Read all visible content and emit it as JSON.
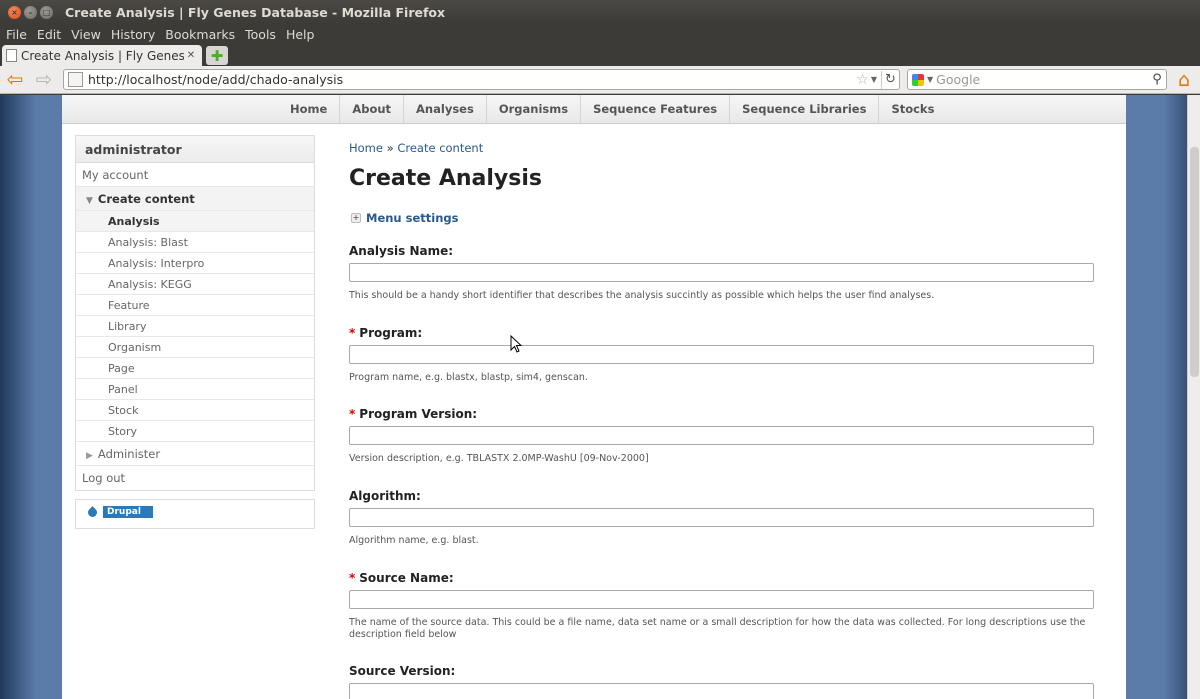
{
  "window": {
    "title": "Create Analysis | Fly Genes Database - Mozilla Firefox"
  },
  "menubar": {
    "items": [
      "File",
      "Edit",
      "View",
      "History",
      "Bookmarks",
      "Tools",
      "Help"
    ]
  },
  "tabs": [
    {
      "label": "Create Analysis | Fly Genes Dat…"
    }
  ],
  "navbar": {
    "url": "http://localhost/node/add/chado-analysis",
    "search_placeholder": "Google"
  },
  "site_nav": {
    "items": [
      "Home",
      "About",
      "Analyses",
      "Organisms",
      "Sequence Features",
      "Sequence Libraries",
      "Stocks"
    ]
  },
  "sidebar": {
    "title": "administrator",
    "my_account": "My account",
    "create_content": "Create content",
    "create_items": [
      "Analysis",
      "Analysis: Blast",
      "Analysis: Interpro",
      "Analysis: KEGG",
      "Feature",
      "Library",
      "Organism",
      "Page",
      "Panel",
      "Stock",
      "Story"
    ],
    "active_item": "Analysis",
    "administer": "Administer",
    "log_out": "Log out",
    "drupal_badge": "Drupal"
  },
  "main": {
    "breadcrumb": {
      "home": "Home",
      "separator": "»",
      "current": "Create content"
    },
    "title": "Create Analysis",
    "menu_settings": "Menu settings",
    "fields": [
      {
        "label": "Analysis Name:",
        "required": false,
        "value": "",
        "description": "This should be a handy short identifier that describes the analysis succintly as possible which helps the user find analyses."
      },
      {
        "label": "Program:",
        "required": true,
        "value": "",
        "description": "Program name, e.g. blastx, blastp, sim4, genscan."
      },
      {
        "label": "Program Version:",
        "required": true,
        "value": "",
        "description": "Version description, e.g. TBLASTX 2.0MP-WashU [09-Nov-2000]"
      },
      {
        "label": "Algorithm:",
        "required": false,
        "value": "",
        "description": "Algorithm name, e.g. blast."
      },
      {
        "label": "Source Name:",
        "required": true,
        "value": "",
        "description": "The name of the source data. This could be a file name, data set name or a small description for how the data was collected. For long descriptions use the description field below"
      },
      {
        "label": "Source Version:",
        "required": false,
        "value": "",
        "description": ""
      }
    ]
  },
  "colors": {
    "link": "#2a5a8c",
    "required_marker": "#dd0000",
    "firefox_orange": "#e2760a"
  }
}
